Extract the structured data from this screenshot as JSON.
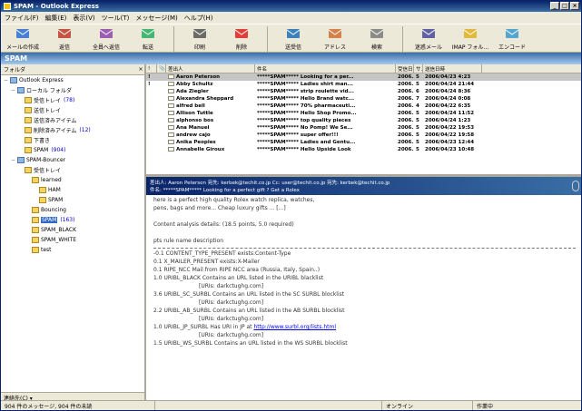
{
  "window": {
    "title": "SPAM - Outlook Express"
  },
  "menu": [
    "ファイル(F)",
    "編集(E)",
    "表示(V)",
    "ツール(T)",
    "メッセージ(M)",
    "ヘルプ(H)"
  ],
  "toolbar": [
    {
      "label": "メールの作成",
      "icon": "new-mail-icon",
      "color": "#2a6fd6"
    },
    {
      "label": "返信",
      "icon": "reply-icon",
      "color": "#c0392b"
    },
    {
      "label": "全員へ返信",
      "icon": "reply-all-icon",
      "color": "#8e44ad"
    },
    {
      "label": "転送",
      "icon": "forward-icon",
      "color": "#27ae60"
    },
    {
      "label": "印刷",
      "icon": "print-icon",
      "color": "#555555"
    },
    {
      "label": "削除",
      "icon": "delete-icon",
      "color": "#e02020"
    },
    {
      "label": "送受信",
      "icon": "send-receive-icon",
      "color": "#1f6fb5"
    },
    {
      "label": "アドレス",
      "icon": "address-icon",
      "color": "#d07030"
    },
    {
      "label": "検索",
      "icon": "find-icon",
      "color": "#7a7a7a"
    },
    {
      "label": "迷惑メール",
      "icon": "junk-icon",
      "color": "#4a4a9a"
    },
    {
      "label": "IMAP フォル...",
      "icon": "imap-folder-icon",
      "color": "#e0b020"
    },
    {
      "label": "エンコード",
      "icon": "encode-icon",
      "color": "#3a9ad0"
    }
  ],
  "folder_bar": {
    "title": "SPAM"
  },
  "folders": {
    "header": "フォルダ",
    "items": [
      {
        "label": "Outlook Express",
        "level": 0,
        "root": true,
        "count": ""
      },
      {
        "label": "ローカル フォルダ",
        "level": 1,
        "root": true,
        "count": ""
      },
      {
        "label": "受信トレイ",
        "level": 2,
        "count": "(78)"
      },
      {
        "label": "送信トレイ",
        "level": 2,
        "count": ""
      },
      {
        "label": "送信済みアイテム",
        "level": 2,
        "count": ""
      },
      {
        "label": "削除済みアイテム",
        "level": 2,
        "count": "(12)"
      },
      {
        "label": "下書き",
        "level": 2,
        "count": ""
      },
      {
        "label": "SPAM",
        "level": 2,
        "count": "(904)"
      },
      {
        "label": "SPAM-Bouncer",
        "level": 1,
        "root": true,
        "count": ""
      },
      {
        "label": "受信トレイ",
        "level": 2,
        "count": ""
      },
      {
        "label": "learned",
        "level": 3,
        "count": ""
      },
      {
        "label": "HAM",
        "level": 4,
        "count": ""
      },
      {
        "label": "SPAM",
        "level": 4,
        "count": ""
      },
      {
        "label": "Bouncing",
        "level": 3,
        "count": ""
      },
      {
        "label": "SPAM",
        "level": 3,
        "count": "(163)",
        "selected": true
      },
      {
        "label": "SPAM_BLACK",
        "level": 3,
        "count": ""
      },
      {
        "label": "SPAM_WHITE",
        "level": 3,
        "count": ""
      },
      {
        "label": "test",
        "level": 3,
        "count": ""
      }
    ],
    "contacts_label": "連絡先(C) ▾"
  },
  "message_list": {
    "columns": [
      "!",
      "📎",
      "差出人",
      "件名",
      "受信日",
      "サ...",
      "送信日時"
    ],
    "rows": [
      {
        "from": "Aaron Peterson",
        "subject": "*****SPAM***** Looking for a per...",
        "size": "2006...",
        "cnt": "5",
        "date": "2006/04/23 4:23",
        "selected": true,
        "flag": "!"
      },
      {
        "from": "Abby Schultz",
        "subject": "*****SPAM***** Ladies shirt man...",
        "size": "2006...",
        "cnt": "5",
        "date": "2006/04/24 21:44",
        "flag": "!"
      },
      {
        "from": "Ada Ziegler",
        "subject": "*****SPAM***** strip roulette vid...",
        "size": "2006...",
        "cnt": "6",
        "date": "2006/04/24 8:36"
      },
      {
        "from": "Alexandra Sheppard",
        "subject": "*****SPAM***** Hello Brand watc...",
        "size": "2006...",
        "cnt": "7",
        "date": "2006/04/24 0:08"
      },
      {
        "from": "alfred bell",
        "subject": "*****SPAM***** 70% pharmaceuti...",
        "size": "2006...",
        "cnt": "4",
        "date": "2006/04/22 6:35"
      },
      {
        "from": "Allison Tuttle",
        "subject": "*****SPAM***** Hello Shop Promo...",
        "size": "2006...",
        "cnt": "5",
        "date": "2006/04/24 11:52"
      },
      {
        "from": "alphonso bos",
        "subject": "*****SPAM***** top quality pieces",
        "size": "2006...",
        "cnt": "5",
        "date": "2006/04/24 1:23"
      },
      {
        "from": "Ana Manuel",
        "subject": "*****SPAM***** No Pomp! We Se...",
        "size": "2006...",
        "cnt": "5",
        "date": "2006/04/22 19:53"
      },
      {
        "from": "andrew cajo",
        "subject": "*****SPAM***** super offer!!!",
        "size": "2006...",
        "cnt": "5",
        "date": "2006/04/22 19:58"
      },
      {
        "from": "Anika Peoples",
        "subject": "*****SPAM***** Ladies and Gentu...",
        "size": "2006...",
        "cnt": "5",
        "date": "2006/04/23 12:44"
      },
      {
        "from": "Annabelle Giroux",
        "subject": "*****SPAM***** Hello Upside Look",
        "size": "2006...",
        "cnt": "5",
        "date": "2006/04/23 10:48"
      }
    ]
  },
  "preview": {
    "line1": "差出人: Aaron Peterson 宛先: kerbek@techit.co.jp Cc: user@techit.co.jp  宛先: kerbek@techit.co.jp",
    "line2": "件名: *****SPAM***** Looking for a perfect gift ? Get a Rolex",
    "body": [
      {
        "text": "here is a perfect high quality Rolex watch replica, watches,",
        "type": "text"
      },
      {
        "text": "pens, bags and more... Cheap luxury gifts ... [...]",
        "type": "text"
      },
      {
        "text": "",
        "type": "text"
      },
      {
        "text": "Content analysis details:  (18.5 points, 5.0 required)",
        "type": "text"
      },
      {
        "text": "",
        "type": "text"
      },
      {
        "text": "pts rule name              description",
        "type": "text"
      },
      {
        "text": "",
        "type": "rule"
      },
      {
        "text": "-0.1 CONTENT_TYPE_PRESENT   exists:Content-Type",
        "type": "text"
      },
      {
        "text": " 0.1 X_MAILER_PRESENT       exists:X-Mailer",
        "type": "text"
      },
      {
        "text": " 0.1 RIPE_NCC               Mail from RIPE NCC area (Russia, Italy, Spain..)",
        "type": "text"
      },
      {
        "text": " 1.0 URIBL_BLACK            Contains an URL listed in the URIBL blacklist",
        "type": "text"
      },
      {
        "text": "[URIs: darkctughg.com]",
        "type": "indent"
      },
      {
        "text": " 3.6 URIBL_SC_SURBL         Contains an URL listed in the SC SURBL blocklist",
        "type": "text"
      },
      {
        "text": "[URIs: darkctughg.com]",
        "type": "indent"
      },
      {
        "text": " 2.2 URIBL_AB_SURBL         Contains an URL listed in the AB SURBL blocklist",
        "type": "text"
      },
      {
        "text": "[URIs: darkctughg.com]",
        "type": "indent"
      },
      {
        "text": " 1.0 URIBL_JP_SURBL         Has URI in JP at http://www.surbl.org/lists.html",
        "type": "link",
        "link": "http://www.surbl.org/lists.html",
        "prefix": " 1.0 URIBL_JP_SURBL         Has URI in JP at "
      },
      {
        "text": "[URIs: darkctughg.com]",
        "type": "indent"
      },
      {
        "text": " 1.5 URIBL_WS_SURBL         Contains an URL listed in the WS SURBL blocklist",
        "type": "text"
      }
    ]
  },
  "status": [
    "904 件のメッセージ, 904 件の未読",
    "",
    "オンライン",
    "作業中"
  ]
}
